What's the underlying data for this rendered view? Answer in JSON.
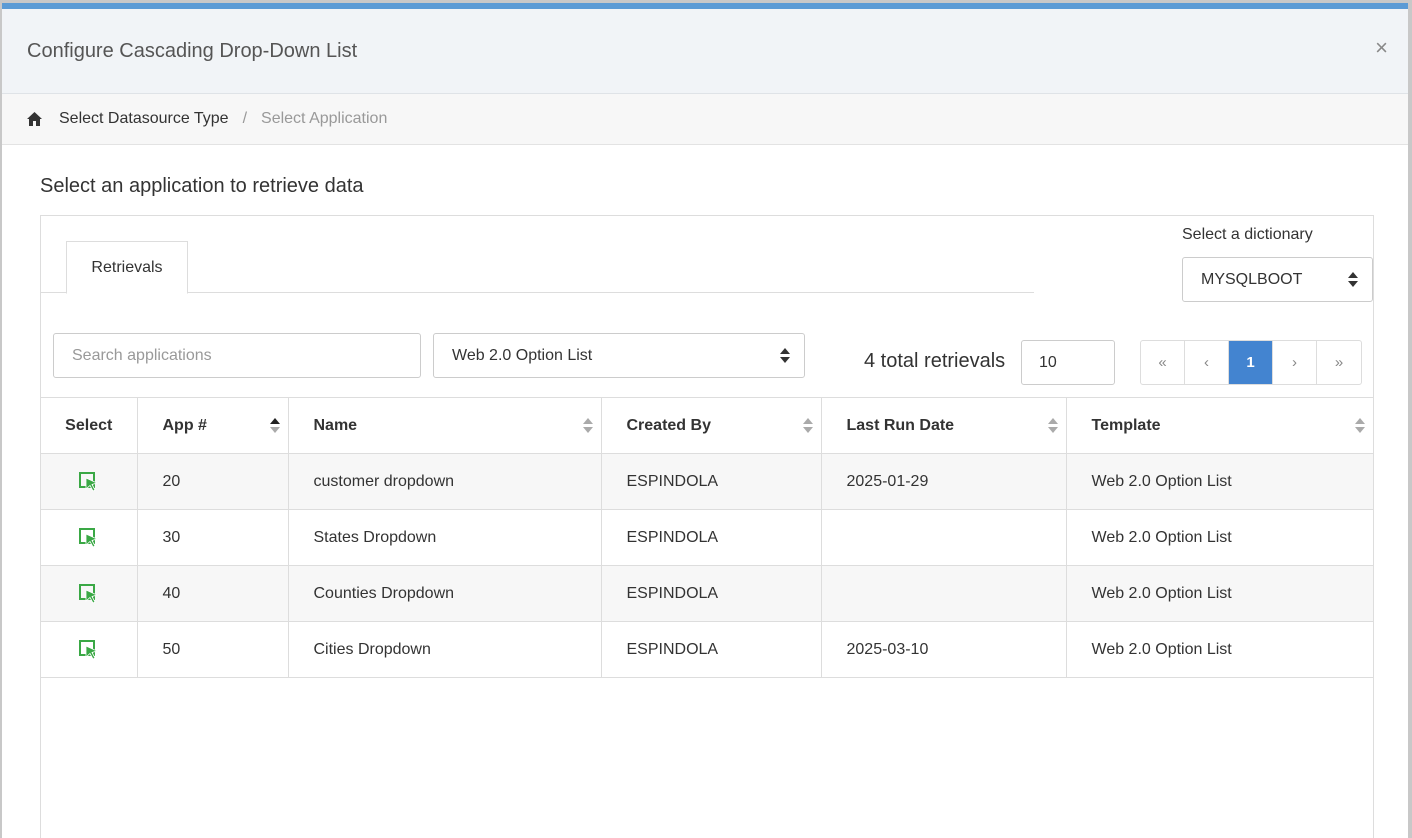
{
  "modal": {
    "title": "Configure Cascading Drop-Down List",
    "close_label": "×"
  },
  "breadcrumb": {
    "icon": "home-icon",
    "items": [
      "Select Datasource Type",
      "Select Application"
    ],
    "separator": "/"
  },
  "section_title": "Select an application to retrieve data",
  "tabs": [
    {
      "label": "Retrievals"
    }
  ],
  "dictionary": {
    "label": "Select a dictionary",
    "value": "MYSQLBOOT"
  },
  "search": {
    "placeholder": "Search applications",
    "value": ""
  },
  "template_filter": {
    "value": "Web 2.0 Option List"
  },
  "total_text": "4 total retrievals",
  "page_size": "10",
  "pager": {
    "first": "«",
    "prev": "‹",
    "current": "1",
    "next": "›",
    "last": "»"
  },
  "table": {
    "columns": [
      "Select",
      "App #",
      "Name",
      "Created By",
      "Last Run Date",
      "Template"
    ],
    "rows": [
      {
        "app": "20",
        "name": "customer dropdown",
        "created_by": "ESPINDOLA",
        "last_run": "2025-01-29",
        "template": "Web 2.0 Option List"
      },
      {
        "app": "30",
        "name": "States Dropdown",
        "created_by": "ESPINDOLA",
        "last_run": "",
        "template": "Web 2.0 Option List"
      },
      {
        "app": "40",
        "name": "Counties Dropdown",
        "created_by": "ESPINDOLA",
        "last_run": "",
        "template": "Web 2.0 Option List"
      },
      {
        "app": "50",
        "name": "Cities Dropdown",
        "created_by": "ESPINDOLA",
        "last_run": "2025-03-10",
        "template": "Web 2.0 Option List"
      }
    ]
  },
  "colors": {
    "accent": "#5b9bd5",
    "pager_active": "#4384d0",
    "select_icon": "#3aa845"
  }
}
